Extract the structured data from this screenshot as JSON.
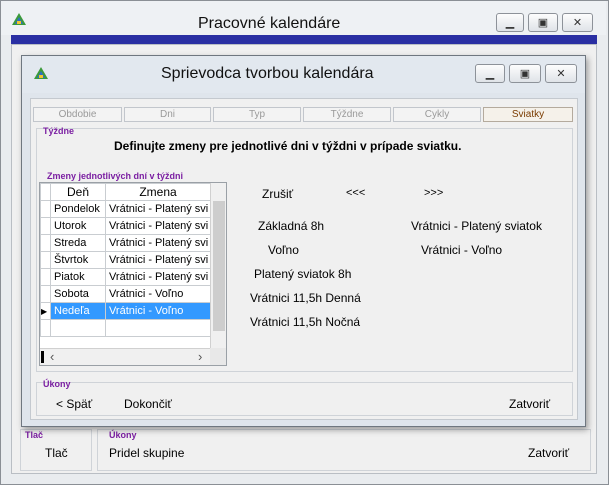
{
  "outer_window": {
    "title": "Pracovné kalendáre",
    "controls": [
      "minimize",
      "maximize",
      "close"
    ],
    "groups": {
      "tlac": {
        "label": "Tlač",
        "button": "Tlač"
      },
      "ukony": {
        "label": "Úkony",
        "left_button": "Pridel skupine",
        "right_button": "Zatvoriť"
      }
    }
  },
  "dialog": {
    "title": "Sprievodca tvorbou kalendára",
    "tabs": [
      "Obdobie",
      "Dni",
      "Typ",
      "Týždne",
      "Cykly",
      "Sviatky"
    ],
    "active_tab": "Sviatky",
    "section_label": "Týždne",
    "instruction": "Definujte zmeny pre jednotlivé dni v týždni v prípade sviatku.",
    "grid_label": "Zmeny jednotlivých dní v týždni",
    "grid_columns": [
      "Deň",
      "Zmena"
    ],
    "grid_rows": [
      {
        "day": "Pondelok",
        "shift": "Vrátnici - Platený svi"
      },
      {
        "day": "Utorok",
        "shift": "Vrátnici - Platený svi"
      },
      {
        "day": "Streda",
        "shift": "Vrátnici - Platený svi"
      },
      {
        "day": "Štvrtok",
        "shift": "Vrátnici - Platený svi"
      },
      {
        "day": "Piatok",
        "shift": "Vrátnici - Platený svi"
      },
      {
        "day": "Sobota",
        "shift": "Vrátnici - Voľno"
      },
      {
        "day": "Nedeľa",
        "shift": "Vrátnici - Voľno"
      }
    ],
    "selected_row": "Nedeľa",
    "actions": {
      "cancel": "Zrušiť",
      "prev": "<<<",
      "next": ">>>"
    },
    "left_list": [
      "Základná 8h",
      "Voľno",
      "Platený sviatok 8h",
      "Vrátnici 11,5h Denná",
      "Vrátnici 11,5h Nočná"
    ],
    "right_list": [
      "Vrátnici - Platený sviatok",
      "Vrátnici - Voľno"
    ],
    "bottom_group": {
      "label": "Úkony",
      "back": "< Späť",
      "finish": "Dokončiť",
      "close": "Zatvoriť"
    }
  }
}
